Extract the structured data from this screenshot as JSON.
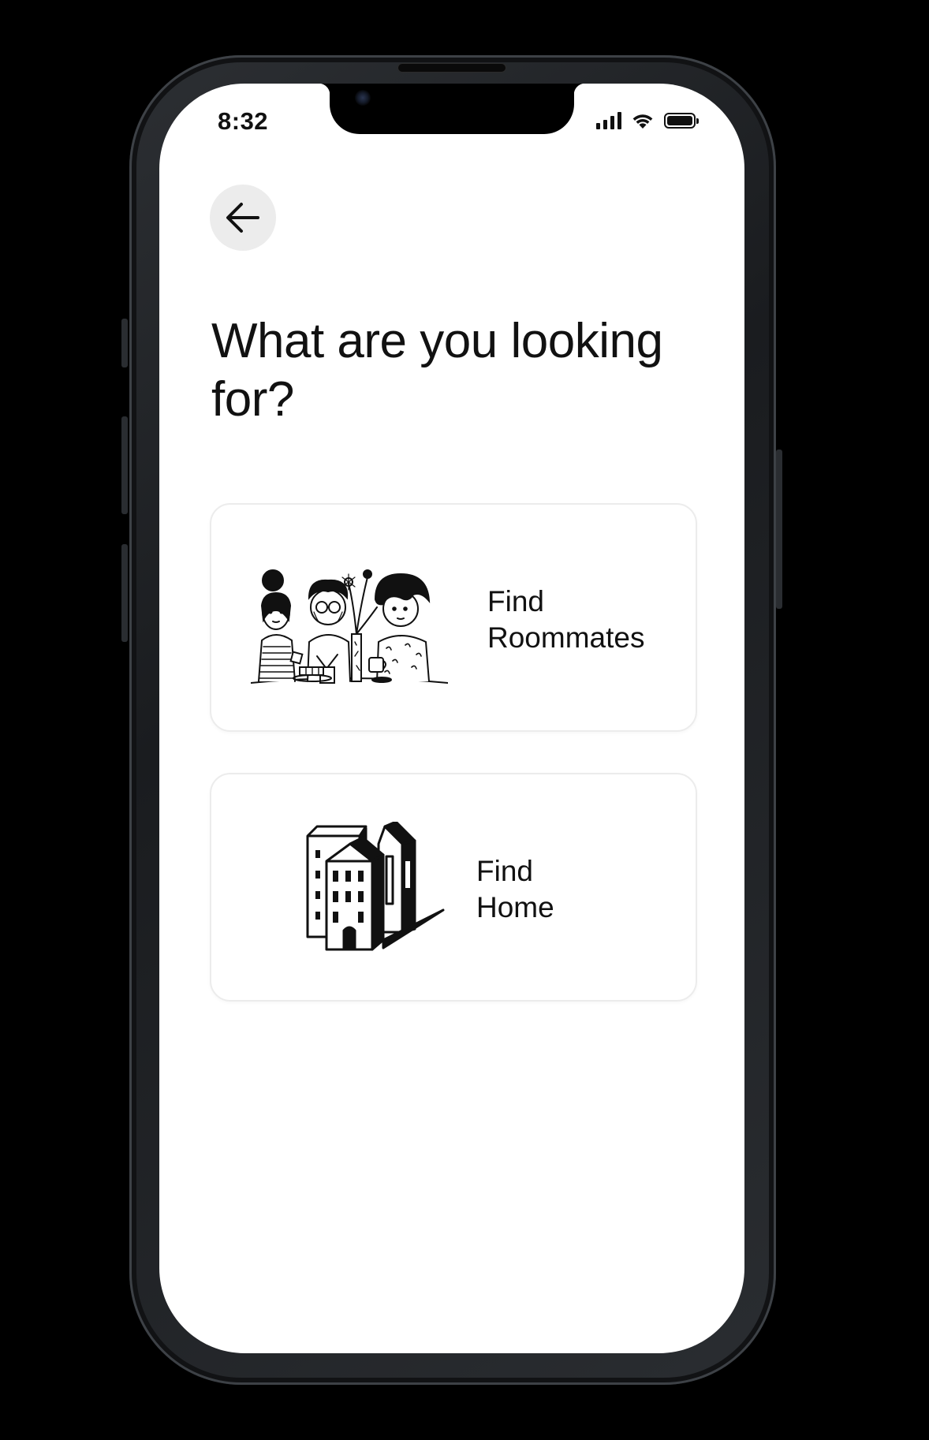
{
  "status_bar": {
    "time": "8:32"
  },
  "header": {
    "title": "What are you looking for?"
  },
  "options": [
    {
      "line1": "Find",
      "line2": "Roommates"
    },
    {
      "line1": "Find",
      "line2": "Home"
    }
  ],
  "colors": {
    "background": "#000000",
    "screen": "#ffffff",
    "text": "#111111",
    "card_border": "#ececec",
    "back_button_bg": "#ececec"
  }
}
